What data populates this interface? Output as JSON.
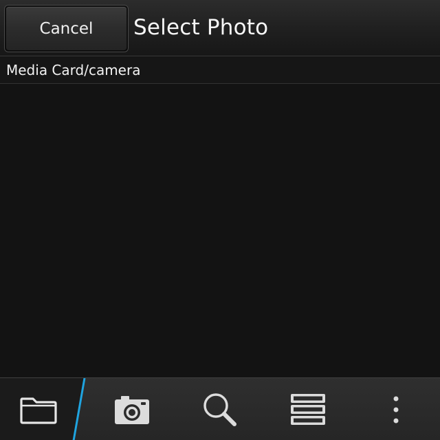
{
  "header": {
    "cancel_label": "Cancel",
    "title": "Select Photo"
  },
  "path": {
    "current": "Media Card/camera"
  },
  "action_bar": {
    "items": [
      {
        "name": "folder",
        "icon": "folder-icon",
        "active": true
      },
      {
        "name": "camera",
        "icon": "camera-icon",
        "active": false
      },
      {
        "name": "search",
        "icon": "search-icon",
        "active": false
      },
      {
        "name": "list-view",
        "icon": "list-view-icon",
        "active": false
      },
      {
        "name": "more",
        "icon": "overflow-menu-icon",
        "active": false
      }
    ],
    "accent_color": "#1fa4e0"
  }
}
